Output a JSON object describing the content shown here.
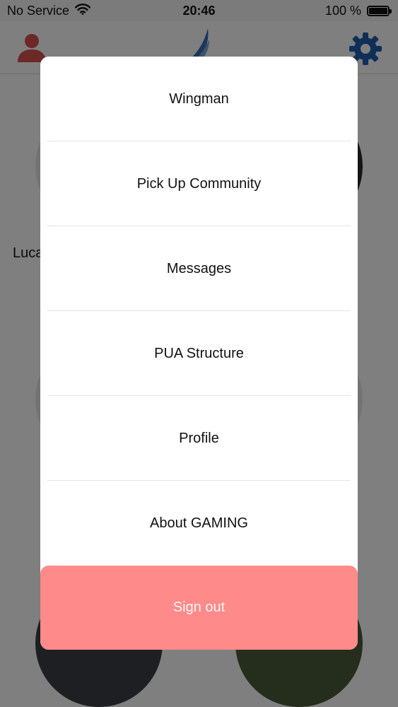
{
  "status_bar": {
    "carrier": "No Service",
    "time": "20:46",
    "battery_percent_label": "100 %",
    "battery_level": 1.0
  },
  "nav": {
    "profile_icon": "person-icon",
    "logo_icon": "wing-logo-icon",
    "settings_icon": "gear-icon"
  },
  "background": {
    "visible_name_fragment": "Luca"
  },
  "menu": {
    "items": [
      {
        "label": "Wingman"
      },
      {
        "label": "Pick Up Community"
      },
      {
        "label": "Messages"
      },
      {
        "label": "PUA Structure"
      },
      {
        "label": "Profile"
      },
      {
        "label": "About GAMING"
      }
    ],
    "sign_out_label": "Sign out"
  },
  "colors": {
    "accent_red": "#d9534f",
    "settings_blue": "#1f5fb0",
    "signout_bg": "#ff8a8a"
  }
}
